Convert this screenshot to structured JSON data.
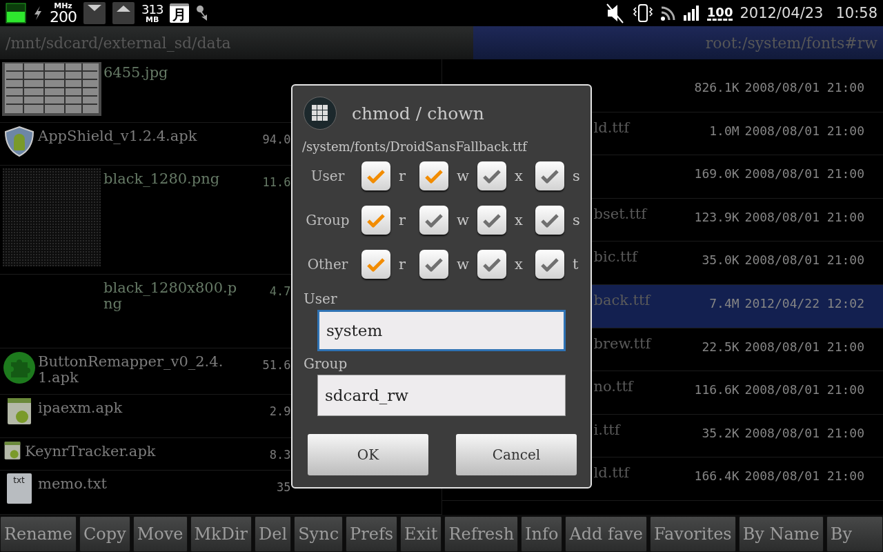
{
  "status_bar": {
    "cpu_clock": {
      "unit": "MHz",
      "value": "200"
    },
    "memory": {
      "value": "313",
      "unit": "MB"
    },
    "calendar_day": "月",
    "battery_level": "100",
    "date": "2012/04/23",
    "time": "10:58"
  },
  "panes": [
    {
      "path": "/mnt/sdcard/external_sd/data",
      "selected": false
    },
    {
      "path": "root:/system/fonts#rw",
      "selected": true
    }
  ],
  "left_files": [
    {
      "kind": "table-thumb",
      "name": "6455.jpg"
    },
    {
      "kind": "shield",
      "name": "AppShield_v1.2.4.apk",
      "size": "94.0"
    },
    {
      "kind": "dots-thumb",
      "name": "black_1280.png",
      "size": "11.6"
    },
    {
      "kind": "blank-thumb",
      "name": "black_1280x800.png",
      "size": "4.7"
    },
    {
      "kind": "puzzle",
      "name": "ButtonRemapper_v0_2.4.1.apk",
      "size": "51.6"
    },
    {
      "kind": "android",
      "name": "ipaexm.apk",
      "size": "2.9"
    },
    {
      "kind": "android-small",
      "name": "KeynrTracker.apk",
      "size": "8.3"
    },
    {
      "kind": "text",
      "icon_label": "txt",
      "name": "memo.txt",
      "size": "35"
    }
  ],
  "right_files": [
    {
      "size": "826.1K",
      "date": "2008/08/01 21:00",
      "selected": false
    },
    {
      "name": "ld.ttf",
      "size": "1.0M",
      "date": "2008/08/01 21:00",
      "selected": false
    },
    {
      "size": "169.0K",
      "date": "2008/08/01 21:00",
      "selected": false
    },
    {
      "name": "bset.ttf",
      "size": "123.9K",
      "date": "2008/08/01 21:00",
      "selected": false
    },
    {
      "name": "bic.ttf",
      "size": "35.0K",
      "date": "2008/08/01 21:00",
      "selected": false
    },
    {
      "name": "back.ttf",
      "size": "7.4M",
      "date": "2012/04/22 12:02",
      "selected": true
    },
    {
      "name": "brew.ttf",
      "size": "22.5K",
      "date": "2008/08/01 21:00",
      "selected": false
    },
    {
      "name": "no.ttf",
      "size": "116.6K",
      "date": "2008/08/01 21:00",
      "selected": false
    },
    {
      "name": "i.ttf",
      "size": "35.2K",
      "date": "2008/08/01 21:00",
      "selected": false
    },
    {
      "name": "ld.ttf",
      "size": "166.4K",
      "date": "2008/08/01 21:00",
      "selected": false
    }
  ],
  "dialog": {
    "title": "chmod / chown",
    "path": "/system/fonts/DroidSansFallback.ttf",
    "permissions": [
      {
        "label": "User",
        "bits": [
          {
            "letter": "r",
            "checked": true
          },
          {
            "letter": "w",
            "checked": true
          },
          {
            "letter": "x",
            "checked": false
          },
          {
            "letter": "s",
            "checked": false
          }
        ]
      },
      {
        "label": "Group",
        "bits": [
          {
            "letter": "r",
            "checked": true
          },
          {
            "letter": "w",
            "checked": false
          },
          {
            "letter": "x",
            "checked": false
          },
          {
            "letter": "s",
            "checked": false
          }
        ]
      },
      {
        "label": "Other",
        "bits": [
          {
            "letter": "r",
            "checked": true
          },
          {
            "letter": "w",
            "checked": false
          },
          {
            "letter": "x",
            "checked": false
          },
          {
            "letter": "t",
            "checked": false
          }
        ]
      }
    ],
    "fields": [
      {
        "label": "User",
        "value": "system",
        "focused": true
      },
      {
        "label": "Group",
        "value": "sdcard_rw",
        "focused": false
      }
    ],
    "buttons": [
      "OK",
      "Cancel"
    ]
  },
  "toolbar": [
    "Rename",
    "Copy",
    "Move",
    "MkDir",
    "Del",
    "Sync",
    "Prefs",
    "Exit",
    "Refresh",
    "Info",
    "Add fave",
    "Favorites",
    "By Name",
    "By"
  ]
}
